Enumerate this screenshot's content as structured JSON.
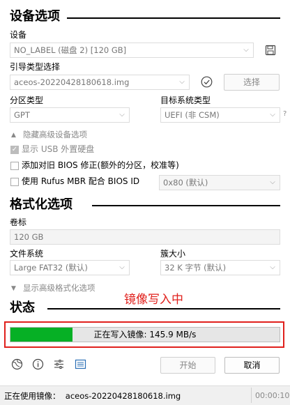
{
  "device_section": {
    "title": "设备选项",
    "device_label": "设备",
    "device_value": "NO_LABEL (磁盘 2) [120 GB]",
    "boot_label": "引导类型选择",
    "boot_value": "aceos-20220428180618.img",
    "select_button": "选择",
    "partition_label": "分区类型",
    "partition_value": "GPT",
    "target_label": "目标系统类型",
    "target_value": "UEFI (非 CSM)",
    "target_help": "?",
    "advanced_toggle": "隐藏高级设备选项",
    "usb_option": "显示 USB 外置硬盘",
    "bios_option": "添加对旧 BIOS 修正(额外的分区，校准等)",
    "rufus_option": "使用 Rufus MBR 配合 BIOS ID",
    "bios_id_value": "0x80 (默认)"
  },
  "format_section": {
    "title": "格式化选项",
    "volume_label": "卷标",
    "volume_value": "120 GB",
    "fs_label": "文件系统",
    "fs_value": "Large FAT32 (默认)",
    "cluster_label": "簇大小",
    "cluster_value": "32 K 字节 (默认)",
    "advanced_toggle": "显示高级格式化选项"
  },
  "status_section": {
    "title": "状态",
    "annotation": "镜像写入中",
    "progress_text": "正在写入镜像: 145.9 MB/s",
    "progress_fraction": 0.23,
    "progress_color": "#06b025",
    "annotation_color": "#e0201c"
  },
  "footer": {
    "start_button": "开始",
    "cancel_button": "取消",
    "status_text": "正在使用镜像：  aceos-20220428180618.img",
    "elapsed": "00:00:10"
  },
  "icons": [
    "save-icon",
    "check-circle-icon",
    "globe-icon",
    "info-icon",
    "settings-sliders-icon",
    "log-icon"
  ]
}
